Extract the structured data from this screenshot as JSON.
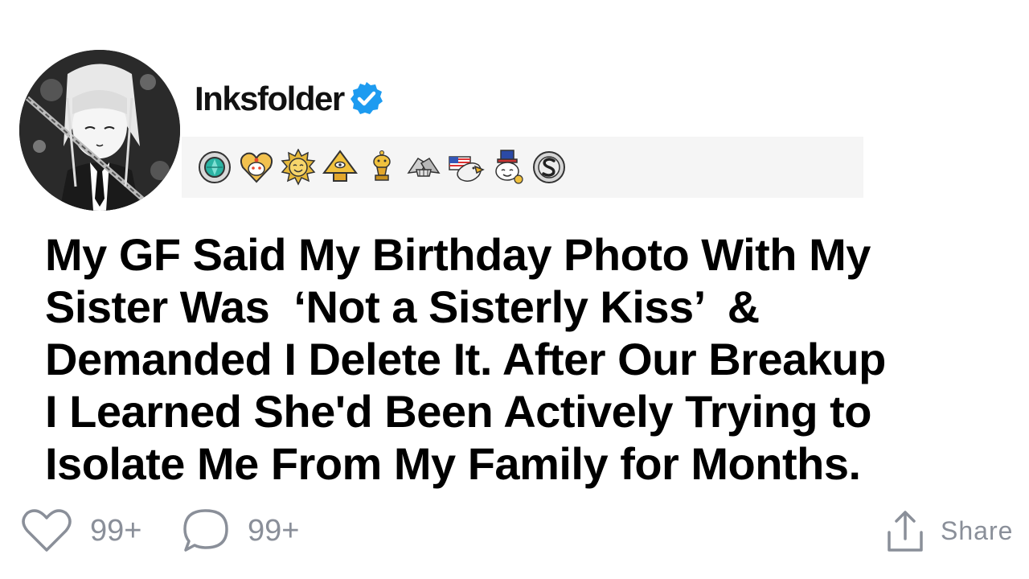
{
  "post": {
    "username": "Inksfolder",
    "verified": true,
    "avatar_icon": "manga-girl-avatar",
    "awards": [
      {
        "icon": "teal-gem-award-icon"
      },
      {
        "icon": "heart-snoo-award-icon"
      },
      {
        "icon": "gold-sun-award-icon"
      },
      {
        "icon": "gold-pyramid-award-icon"
      },
      {
        "icon": "gold-trophy-snoo-award-icon"
      },
      {
        "icon": "handshake-award-icon"
      },
      {
        "icon": "eagle-flag-award-icon"
      },
      {
        "icon": "snoo-top-hat-award-icon"
      },
      {
        "icon": "silver-s-award-icon"
      }
    ],
    "title_lines": [
      "My GF Said My Birthday Photo With My",
      "Sister Was  ‘Not a Sisterly Kiss’  &",
      "Demanded I Delete It. After Our Breakup",
      "I Learned She'd Been Actively Trying to",
      "Isolate Me From My Family for Months."
    ],
    "likes": "99+",
    "comments": "99+",
    "share_label": "Share"
  },
  "colors": {
    "verified": "#1d9bf0",
    "muted_text": "#8a8f99",
    "awards_background": "#f5f5f5",
    "title_text": "#000000"
  }
}
